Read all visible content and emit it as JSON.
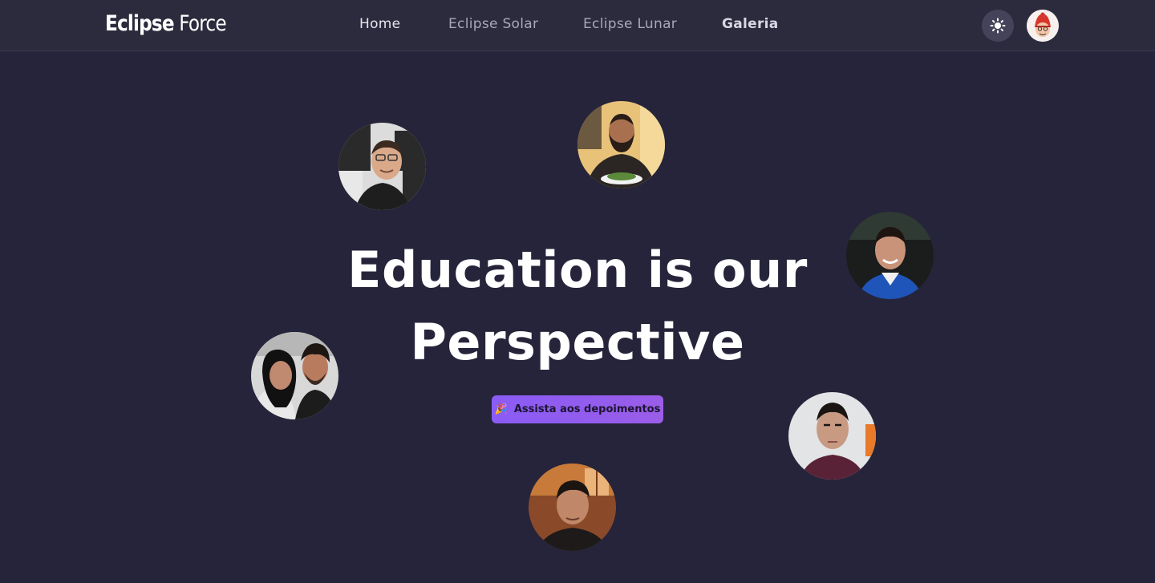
{
  "header": {
    "logo_bold": "Eclipse",
    "logo_light": " Force",
    "nav": [
      {
        "label": "Home"
      },
      {
        "label": "Eclipse Solar"
      },
      {
        "label": "Eclipse Lunar"
      },
      {
        "label": "Galeria"
      }
    ],
    "theme_icon": "sun-icon",
    "avatar_icon": "user-avatar"
  },
  "hero": {
    "title_line1": "Education is our",
    "title_line2": "Perspective",
    "cta_icon": "🎉",
    "cta_label": "Assista aos depoimentos"
  },
  "colors": {
    "background": "#26243a",
    "header": "#2c2b3d",
    "accent": "#8a5cf5"
  }
}
